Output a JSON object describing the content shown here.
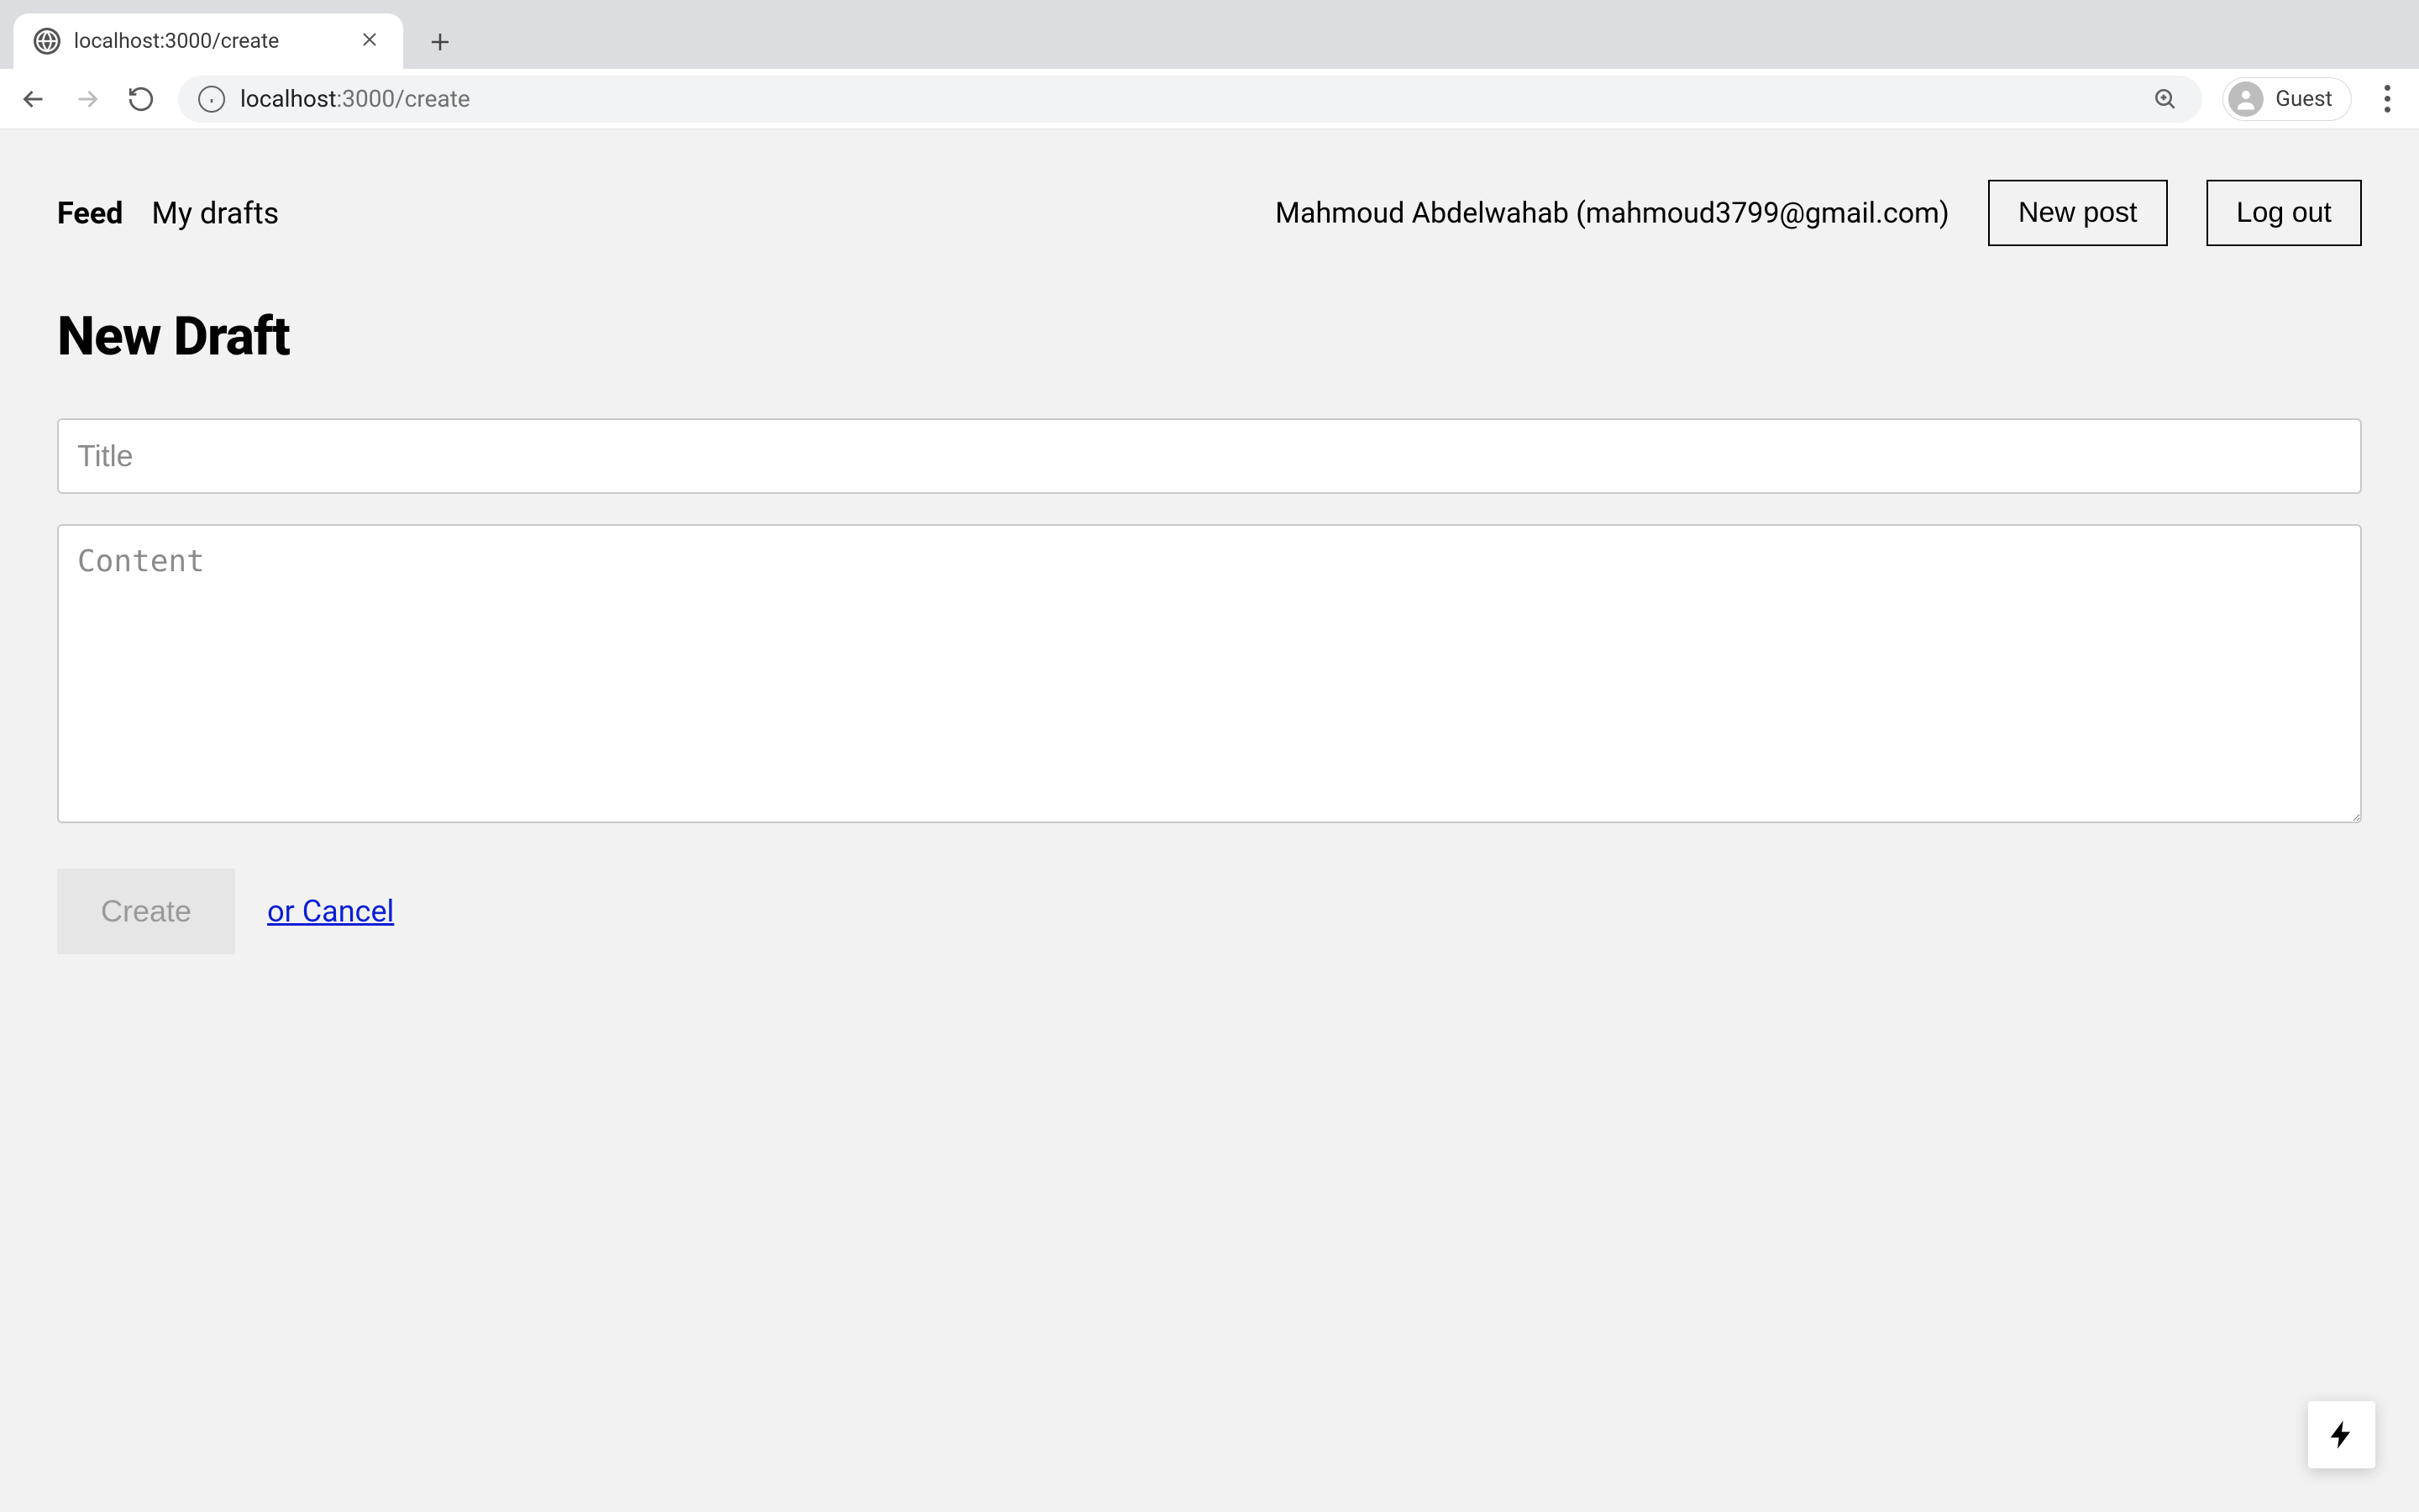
{
  "browser": {
    "tab_title": "localhost:3000/create",
    "url_host": "localhost",
    "url_port_path": ":3000/create",
    "profile_label": "Guest"
  },
  "nav": {
    "feed": "Feed",
    "drafts": "My drafts",
    "user_display": "Mahmoud Abdelwahab (mahmoud3799@gmail.com)",
    "new_post": "New post",
    "log_out": "Log out"
  },
  "form": {
    "heading": "New Draft",
    "title_placeholder": "Title",
    "title_value": "",
    "content_placeholder": "Content",
    "content_value": "",
    "create_label": "Create",
    "cancel_label": "or Cancel"
  }
}
